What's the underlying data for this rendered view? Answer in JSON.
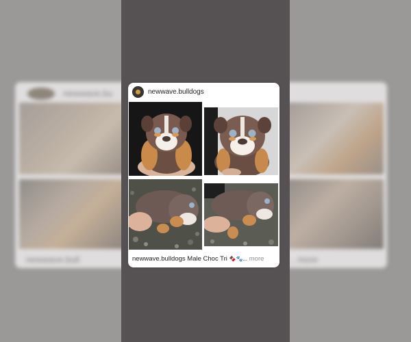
{
  "post": {
    "username": "newwave.bulldogs",
    "caption_user": "newwave.bulldogs",
    "caption_text": "Male Choc Tri",
    "caption_emoji": "🍫🐾...",
    "more_label": "more",
    "photos": [
      {
        "name": "puppy-photo-1",
        "subject": "tri-color bulldog puppy held in hand"
      },
      {
        "name": "puppy-photo-2",
        "subject": "chocolate tri bulldog puppy face"
      },
      {
        "name": "puppy-photo-3",
        "subject": "bulldog puppy lying on gravel"
      },
      {
        "name": "puppy-photo-4",
        "subject": "bulldog puppy lying on gravel with hand"
      }
    ]
  },
  "background": {
    "left_caption": "newwave.bull",
    "left_header": "newwave.bu",
    "right_caption": "... more"
  },
  "colors": {
    "backdrop": "#9b9898",
    "center_strip": "#565153",
    "card": "#ffffff",
    "more_text": "#8e8e8e"
  }
}
